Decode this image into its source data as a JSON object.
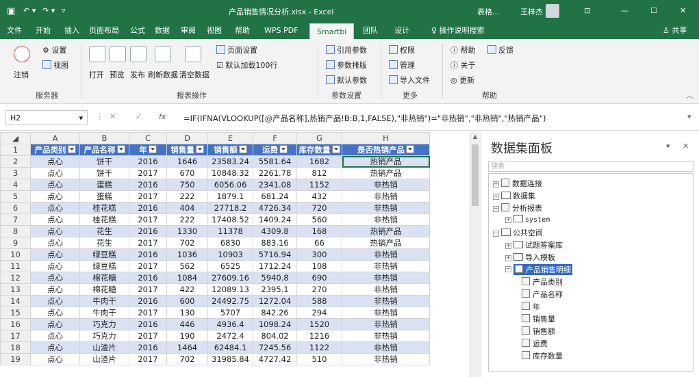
{
  "window": {
    "title": "产品销售情况分析.xlsx - Excel",
    "account_label": "表格...",
    "user_name": "王梓杰",
    "colors": {
      "accent": "#217346",
      "header_fill": "#4472c4",
      "band_fill": "#d9e1f2",
      "selected_node": "#316ac5"
    }
  },
  "tabs": [
    "文件",
    "开始",
    "插入",
    "页面布局",
    "公式",
    "数据",
    "审阅",
    "视图",
    "帮助",
    "WPS PDF",
    "Smartbi",
    "团队",
    "设计"
  ],
  "active_tab": "Smartbi",
  "tell_me": "操作说明搜索",
  "share": "共享",
  "ribbon": {
    "server": {
      "settings": "设置",
      "view": "视图",
      "logout": "注销",
      "group": "服务器"
    },
    "report": {
      "open": "打开",
      "preview": "预览",
      "publish": "发布",
      "refresh": "刷新数据",
      "clear": "清空数据",
      "page_setup": "页面设置",
      "default_load": "默认加载100行",
      "group": "报表操作"
    },
    "params": {
      "ref_params": "引用参数",
      "param_layout": "参数排版",
      "default_params": "默认参数",
      "group": "参数设置"
    },
    "more": {
      "permission": "权限",
      "manage": "管理",
      "import_file": "导入文件",
      "group": "更多"
    },
    "help": {
      "help": "帮助",
      "feedback": "反馈",
      "about": "关于",
      "update": "更新",
      "group": "帮助"
    }
  },
  "formula_bar": {
    "cell_ref": "H2",
    "formula": "=IF(IFNA(VLOOKUP([@产品名称],热销产品!B:B,1,FALSE),\"非热销\")=\"非热销\",\"非热销\",\"热销产品\")"
  },
  "sheet": {
    "column_letters": [
      "A",
      "B",
      "C",
      "D",
      "E",
      "F",
      "G",
      "H"
    ],
    "headers": [
      "产品类别",
      "产品名称",
      "年",
      "销售量",
      "销售额",
      "运费",
      "库存数量",
      "是否热销产品"
    ],
    "rows": [
      {
        "n": "2",
        "cells": [
          "点心",
          "饼干",
          "2016",
          "1646",
          "23583.24",
          "5581.64",
          "1682",
          "热销产品"
        ]
      },
      {
        "n": "3",
        "cells": [
          "点心",
          "饼干",
          "2017",
          "670",
          "10848.32",
          "2261.78",
          "812",
          "热销产品"
        ]
      },
      {
        "n": "4",
        "cells": [
          "点心",
          "蛋糕",
          "2016",
          "750",
          "6056.06",
          "2341.08",
          "1152",
          "非热销"
        ]
      },
      {
        "n": "5",
        "cells": [
          "点心",
          "蛋糕",
          "2017",
          "222",
          "1879.1",
          "681.24",
          "432",
          "非热销"
        ]
      },
      {
        "n": "6",
        "cells": [
          "点心",
          "桂花糕",
          "2016",
          "404",
          "27718.2",
          "4726.34",
          "720",
          "非热销"
        ]
      },
      {
        "n": "7",
        "cells": [
          "点心",
          "桂花糕",
          "2017",
          "222",
          "17408.52",
          "1409.24",
          "560",
          "非热销"
        ]
      },
      {
        "n": "8",
        "cells": [
          "点心",
          "花生",
          "2016",
          "1330",
          "11378",
          "4309.8",
          "168",
          "热销产品"
        ]
      },
      {
        "n": "9",
        "cells": [
          "点心",
          "花生",
          "2017",
          "702",
          "6830",
          "883.16",
          "66",
          "热销产品"
        ]
      },
      {
        "n": "10",
        "cells": [
          "点心",
          "绿豆糕",
          "2016",
          "1036",
          "10903",
          "5716.94",
          "300",
          "非热销"
        ]
      },
      {
        "n": "11",
        "cells": [
          "点心",
          "绿豆糕",
          "2017",
          "562",
          "6525",
          "1712.24",
          "108",
          "非热销"
        ]
      },
      {
        "n": "12",
        "cells": [
          "点心",
          "棉花糖",
          "2016",
          "1084",
          "27609.16",
          "5940.8",
          "690",
          "非热销"
        ]
      },
      {
        "n": "13",
        "cells": [
          "点心",
          "棉花糖",
          "2017",
          "422",
          "12089.13",
          "2395.1",
          "270",
          "非热销"
        ]
      },
      {
        "n": "14",
        "cells": [
          "点心",
          "牛肉干",
          "2016",
          "600",
          "24492.75",
          "1272.04",
          "588",
          "非热销"
        ]
      },
      {
        "n": "15",
        "cells": [
          "点心",
          "牛肉干",
          "2017",
          "130",
          "5707",
          "842.26",
          "294",
          "非热销"
        ]
      },
      {
        "n": "16",
        "cells": [
          "点心",
          "巧克力",
          "2016",
          "446",
          "4936.4",
          "1098.24",
          "1520",
          "非热销"
        ]
      },
      {
        "n": "17",
        "cells": [
          "点心",
          "巧克力",
          "2017",
          "190",
          "2472.4",
          "804.02",
          "1216",
          "非热销"
        ]
      },
      {
        "n": "18",
        "cells": [
          "点心",
          "山渣片",
          "2016",
          "1464",
          "62484.1",
          "7245.56",
          "1122",
          "非热销"
        ]
      },
      {
        "n": "19",
        "cells": [
          "点心",
          "山渣片",
          "2017",
          "702",
          "31985.84",
          "4727.42",
          "510",
          "非热销"
        ]
      }
    ]
  },
  "panel": {
    "title": "数据集面板",
    "search_placeholder": "搜索",
    "tree": {
      "data_connection": "数据连接",
      "dataset": "数据集",
      "analysis_reports": "分析报表",
      "system": "system",
      "public_space": "公共空间",
      "exam_answers": "试题答案库",
      "import_template": "导入模板",
      "selected": "产品销售明细",
      "fields": [
        "产品类别",
        "产品名称",
        "年",
        "销售量",
        "销售额",
        "运费",
        "库存数量"
      ]
    }
  }
}
